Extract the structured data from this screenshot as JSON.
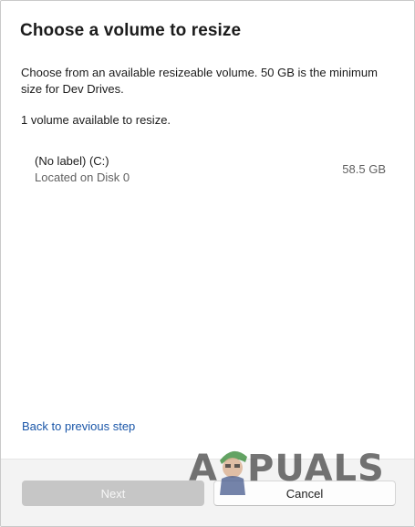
{
  "dialog": {
    "title": "Choose a volume to resize",
    "description": "Choose from an available resizeable volume. 50 GB is the minimum size for Dev Drives.",
    "count_text": "1 volume available to resize."
  },
  "volumes": [
    {
      "name": "(No label) (C:)",
      "location": "Located on Disk 0",
      "size": "58.5 GB"
    }
  ],
  "back_link": "Back to previous step",
  "footer": {
    "next_label": "Next",
    "cancel_label": "Cancel"
  },
  "watermark": {
    "left": "A",
    "right": "PUALS"
  },
  "colors": {
    "link": "#1a56a8",
    "disabled_button": "#c6c6c6",
    "footer_bg": "#f3f3f3"
  }
}
